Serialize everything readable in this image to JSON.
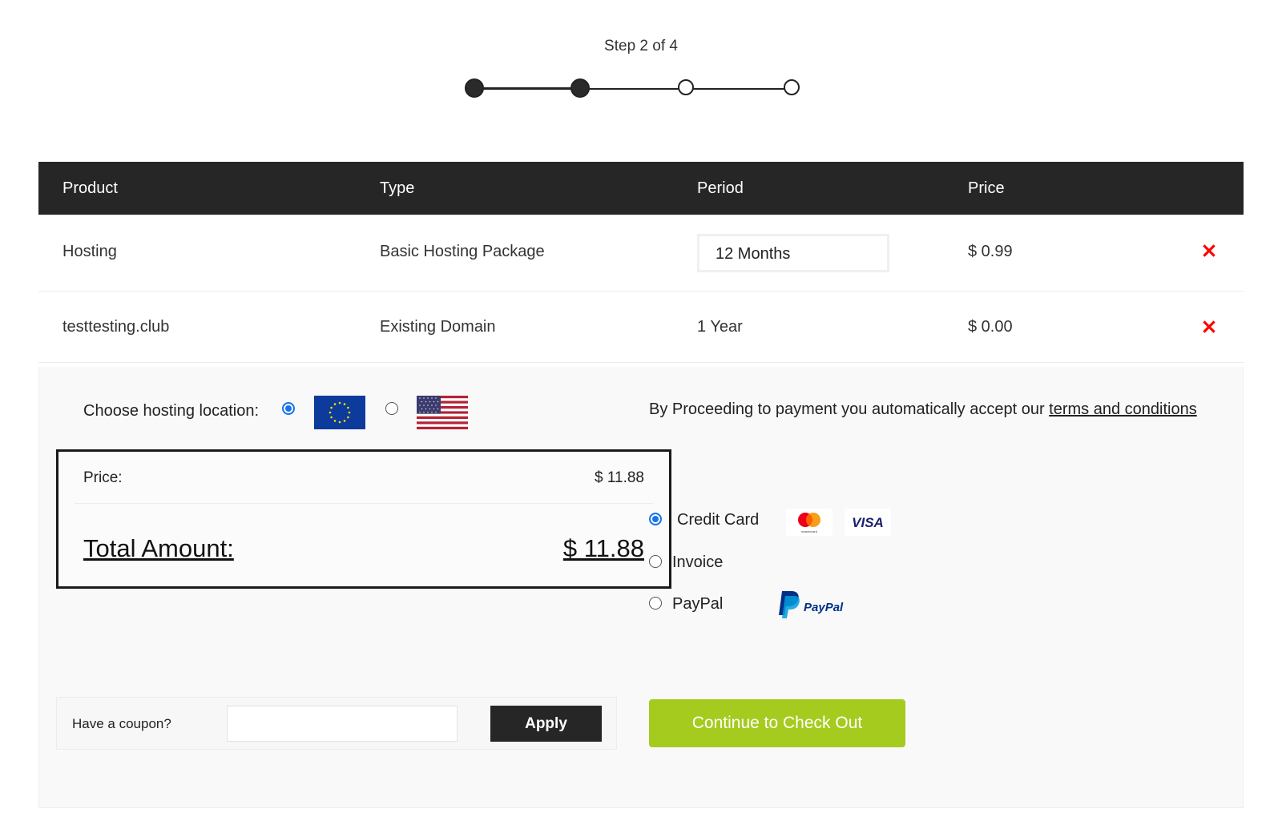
{
  "stepper": {
    "label": "Step 2 of 4",
    "current_step": 2,
    "total_steps": 4
  },
  "table": {
    "headers": [
      "Product",
      "Type",
      "Period",
      "Price"
    ],
    "rows": [
      {
        "product": "Hosting",
        "type": "Basic Hosting Package",
        "period": "12 Months",
        "price": "$ 0.99"
      },
      {
        "product": "testtesting.club",
        "type": "Existing Domain",
        "period": "1 Year",
        "price": "$ 0.00"
      }
    ],
    "remove_icon": "close-x-icon",
    "remove_color": "#ff0000",
    "header_bg": "#262626"
  },
  "location": {
    "label": "Choose hosting location:",
    "options": [
      {
        "name": "EU",
        "icon": "eu-flag-icon",
        "selected": true
      },
      {
        "name": "US",
        "icon": "us-flag-icon",
        "selected": false
      }
    ]
  },
  "terms": {
    "text": "By Proceeding to payment you automatically accept our ",
    "link": "terms and conditions"
  },
  "summary": {
    "price_label": "Price:",
    "price_value": "$ 11.88",
    "total_label": "Total Amount:",
    "total_value": "$ 11.88"
  },
  "payment": {
    "options": [
      {
        "label": "Credit Card",
        "selected": true,
        "logos": [
          "mastercard-logo",
          "visa-logo"
        ]
      },
      {
        "label": "Invoice",
        "selected": false
      },
      {
        "label": "PayPal",
        "selected": false,
        "logos": [
          "paypal-logo"
        ]
      }
    ],
    "visa_text": "VISA",
    "mastercard_text": "mastercard",
    "paypal_text": "PayPal"
  },
  "coupon": {
    "label": "Have a coupon?",
    "value": "",
    "placeholder": "",
    "apply_label": "Apply"
  },
  "checkout": {
    "label": "Continue to Check Out",
    "color": "#a6cb1f"
  }
}
